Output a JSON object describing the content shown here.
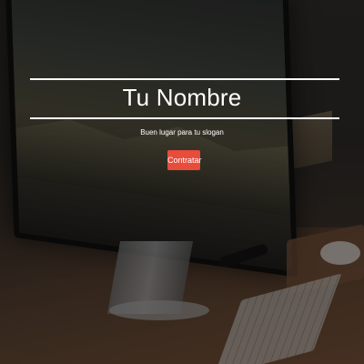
{
  "hero": {
    "title": "Tu Nombre",
    "slogan": "Buen lugar para tu slogan",
    "cta_label": "Contratar"
  },
  "colors": {
    "accent": "#e74c3c",
    "text": "#ffffff",
    "overlay": "rgba(0,0,0,0.35)"
  }
}
